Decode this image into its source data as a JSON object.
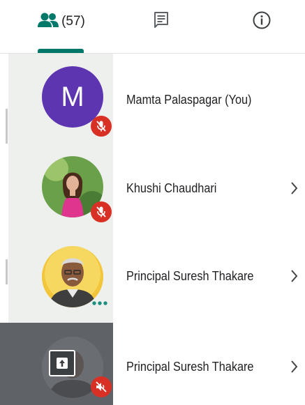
{
  "tabs": {
    "people_count": "(57)",
    "chat_icon": "chat-icon",
    "info_icon": "info-icon"
  },
  "participants": [
    {
      "initial": "M",
      "name": "Mamta Palaspagar (You)",
      "status": "muted"
    },
    {
      "name": "Khushi Chaudhari",
      "status": "muted"
    },
    {
      "name": "Principal Suresh Thakare",
      "status": "speaking"
    },
    {
      "name": "Principal Suresh Thakare",
      "status": "presenting-muted"
    }
  ],
  "colors": {
    "accent": "#00796b",
    "avatar_purple": "#5e35b1",
    "mute_red": "#d93025",
    "row_bg": "#eef0ee",
    "presenting_bg": "#5f6368"
  }
}
